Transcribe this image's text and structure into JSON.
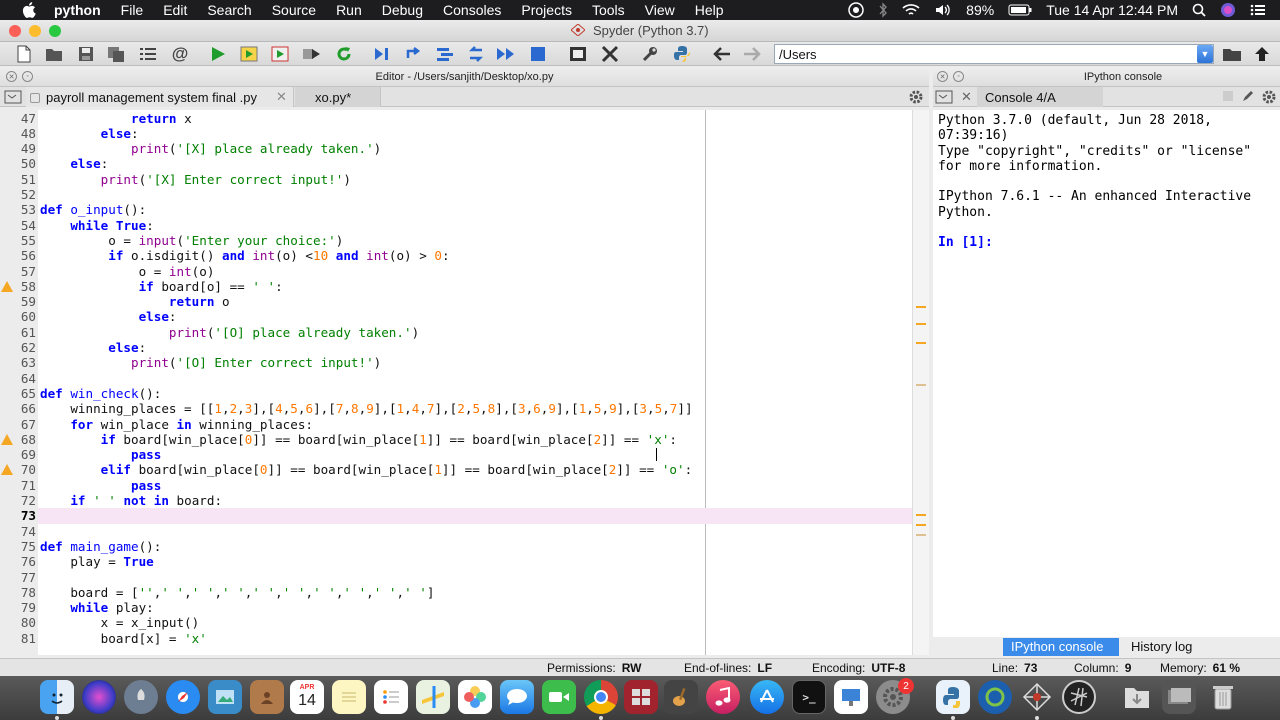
{
  "menubar": {
    "items": [
      "python",
      "File",
      "Edit",
      "Search",
      "Source",
      "Run",
      "Debug",
      "Consoles",
      "Projects",
      "Tools",
      "View",
      "Help"
    ],
    "battery": "89%",
    "datetime": "Tue 14 Apr  12:44 PM"
  },
  "window": {
    "title": "Spyder (Python 3.7)"
  },
  "toolbar": {
    "working_dir": "/Users"
  },
  "editor": {
    "pane_title": "Editor - /Users/sanjith/Desktop/xo.py",
    "tabs": [
      "payroll management system final .py",
      "xo.py*"
    ],
    "current_line": 73,
    "lines": [
      {
        "n": "47",
        "warn": false,
        "html": "            <span class=\"k\">return</span> x"
      },
      {
        "n": "48",
        "warn": false,
        "html": "        <span class=\"k\">else</span>:"
      },
      {
        "n": "49",
        "warn": false,
        "html": "            <span class=\"b\">print</span>(<span class=\"s\">'[X] place already taken.'</span>)"
      },
      {
        "n": "50",
        "warn": false,
        "html": "    <span class=\"k\">else</span>:"
      },
      {
        "n": "51",
        "warn": false,
        "html": "        <span class=\"b\">print</span>(<span class=\"s\">'[X] Enter correct input!'</span>)"
      },
      {
        "n": "52",
        "warn": false,
        "html": ""
      },
      {
        "n": "53",
        "warn": false,
        "html": "<span class=\"k\">def</span> <span class=\"d\">o_input</span>():"
      },
      {
        "n": "54",
        "warn": false,
        "html": "    <span class=\"k\">while</span> <span class=\"k\">True</span>:"
      },
      {
        "n": "55",
        "warn": false,
        "html": "         o = <span class=\"b\">input</span>(<span class=\"s\">'Enter your choice:'</span>)"
      },
      {
        "n": "56",
        "warn": false,
        "html": "         <span class=\"k\">if</span> o.isdigit() <span class=\"k\">and</span> <span class=\"b\">int</span>(o) &lt;<span class=\"n\">10</span> <span class=\"k\">and</span> <span class=\"b\">int</span>(o) &gt; <span class=\"n\">0</span>:"
      },
      {
        "n": "57",
        "warn": false,
        "html": "             o = <span class=\"b\">int</span>(o)"
      },
      {
        "n": "58",
        "warn": true,
        "html": "             <span class=\"k\">if</span> board[o] == <span class=\"s\">' '</span>:"
      },
      {
        "n": "59",
        "warn": false,
        "html": "                 <span class=\"k\">return</span> o"
      },
      {
        "n": "60",
        "warn": false,
        "html": "             <span class=\"k\">else</span>:"
      },
      {
        "n": "61",
        "warn": false,
        "html": "                 <span class=\"b\">print</span>(<span class=\"s\">'[O] place already taken.'</span>)"
      },
      {
        "n": "62",
        "warn": false,
        "html": "         <span class=\"k\">else</span>:"
      },
      {
        "n": "63",
        "warn": false,
        "html": "            <span class=\"b\">print</span>(<span class=\"s\">'[O] Enter correct input!'</span>)"
      },
      {
        "n": "64",
        "warn": false,
        "html": ""
      },
      {
        "n": "65",
        "warn": false,
        "html": "<span class=\"k\">def</span> <span class=\"d\">win_check</span>():"
      },
      {
        "n": "66",
        "warn": false,
        "html": "    winning_places = [[<span class=\"n\">1</span>,<span class=\"n\">2</span>,<span class=\"n\">3</span>],[<span class=\"n\">4</span>,<span class=\"n\">5</span>,<span class=\"n\">6</span>],[<span class=\"n\">7</span>,<span class=\"n\">8</span>,<span class=\"n\">9</span>],[<span class=\"n\">1</span>,<span class=\"n\">4</span>,<span class=\"n\">7</span>],[<span class=\"n\">2</span>,<span class=\"n\">5</span>,<span class=\"n\">8</span>],[<span class=\"n\">3</span>,<span class=\"n\">6</span>,<span class=\"n\">9</span>],[<span class=\"n\">1</span>,<span class=\"n\">5</span>,<span class=\"n\">9</span>],[<span class=\"n\">3</span>,<span class=\"n\">5</span>,<span class=\"n\">7</span>]]"
      },
      {
        "n": "67",
        "warn": false,
        "html": "    <span class=\"k\">for</span> win_place <span class=\"k\">in</span> winning_places:"
      },
      {
        "n": "68",
        "warn": true,
        "html": "        <span class=\"k\">if</span> board[win_place[<span class=\"n\">0</span>]] == board[win_place[<span class=\"n\">1</span>]] == board[win_place[<span class=\"n\">2</span>]] == <span class=\"s\">'x'</span>:"
      },
      {
        "n": "69",
        "warn": false,
        "html": "            <span class=\"k\">pass</span>"
      },
      {
        "n": "70",
        "warn": true,
        "html": "        <span class=\"k\">elif</span> board[win_place[<span class=\"n\">0</span>]] == board[win_place[<span class=\"n\">1</span>]] == board[win_place[<span class=\"n\">2</span>]] == <span class=\"s\">'o'</span>:"
      },
      {
        "n": "71",
        "warn": false,
        "html": "            <span class=\"k\">pass</span>"
      },
      {
        "n": "72",
        "warn": false,
        "html": "    <span class=\"k\">if</span> <span class=\"s\">' '</span> <span class=\"k\">not</span> <span class=\"k\">in</span> board:"
      },
      {
        "n": "73",
        "warn": false,
        "html": ""
      },
      {
        "n": "74",
        "warn": false,
        "html": ""
      },
      {
        "n": "75",
        "warn": false,
        "html": "<span class=\"k\">def</span> <span class=\"d\">main_game</span>():"
      },
      {
        "n": "76",
        "warn": false,
        "html": "    play = <span class=\"k\">True</span>"
      },
      {
        "n": "77",
        "warn": false,
        "html": ""
      },
      {
        "n": "78",
        "warn": false,
        "html": "    board = [<span class=\"s\">''</span>,<span class=\"s\">' '</span>,<span class=\"s\">' '</span>,<span class=\"s\">' '</span>,<span class=\"s\">' '</span>,<span class=\"s\">' '</span>,<span class=\"s\">' '</span>,<span class=\"s\">' '</span>,<span class=\"s\">' '</span>,<span class=\"s\">' '</span>]"
      },
      {
        "n": "79",
        "warn": false,
        "html": "    <span class=\"k\">while</span> play:"
      },
      {
        "n": "80",
        "warn": false,
        "html": "        x = x_input()"
      },
      {
        "n": "81",
        "warn": false,
        "html": "        board[x] = <span class=\"s\">'x'</span>"
      }
    ]
  },
  "console": {
    "pane_title": "IPython console",
    "tab": "Console 4/A",
    "lines": [
      "Python 3.7.0 (default, Jun 28 2018,",
      "07:39:16)",
      "Type \"copyright\", \"credits\" or \"license\"",
      "for more information.",
      "",
      "IPython 7.6.1 -- An enhanced Interactive",
      "Python.",
      ""
    ],
    "prompt": "In [1]:",
    "bottom_tabs": [
      "IPython console",
      "History log"
    ]
  },
  "statusbar": {
    "permissions_label": "Permissions:",
    "permissions": "RW",
    "eol_label": "End-of-lines:",
    "eol": "LF",
    "encoding_label": "Encoding:",
    "encoding": "UTF-8",
    "line_label": "Line:",
    "line": "73",
    "column_label": "Column:",
    "column": "9",
    "memory_label": "Memory:",
    "memory": "61 %"
  },
  "dock": {
    "calendar_day": "14",
    "calendar_month": "APR",
    "badge": "2"
  },
  "colors": {
    "keyword": "#0000ff",
    "builtin": "#900090",
    "string": "#008000",
    "number": "#ff7700",
    "active_tab": "#3b8beb"
  }
}
